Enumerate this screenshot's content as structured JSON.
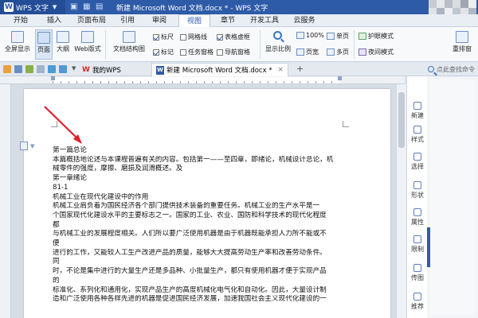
{
  "titlebar": {
    "app_name": "WPS 文字",
    "doc_title": "新建 Microsoft Word 文档.docx * - WPS 文字"
  },
  "menu_tabs": [
    "开始",
    "插入",
    "页面布局",
    "引用",
    "审阅",
    "视图",
    "章节",
    "开发工具",
    "云服务"
  ],
  "active_menu_tab": "视图",
  "ribbon": {
    "fullscreen": "全屏显示",
    "page_view": "页面",
    "outline": "大纲",
    "web_view": "Web版式",
    "doc_map": "文档结构图",
    "ruler": "标尺",
    "gridlines": "网格线",
    "table_gridlines": "表格虚框",
    "markup": "标记",
    "task_pane": "任务窗格",
    "nav_window": "导航窗格",
    "zoom": "显示比例",
    "zoom_100": "100%",
    "one_page": "单页",
    "page_width": "页宽",
    "multi_page": "多页",
    "eye_protect": "护眼模式",
    "night_mode": "夜间模式",
    "rearrange": "重排窗"
  },
  "doc_tabs": [
    {
      "label": "我的WPS"
    },
    {
      "label": "新建 Microsoft Word 文档.docx *"
    }
  ],
  "new_tab": "+",
  "search": {
    "placeholder": "点此查找命令"
  },
  "document_lines": [
    "第一篇总论",
    "本篇概括地论述与本课程普遍有关的内容。包括第一——至四章，即绪论，机械设计总论，机",
    "械零件的强度，摩擦、磨损及润滑概述。及",
    "第一章绪论",
    "81-1",
    "机械工业在现代化建设中的作用",
    "机械工业肩负着为国民经济各个部门提供技术装备的重要任务。机械工业的生产水平是一",
    "个国家现代化建设水平的主要标志之一。国家的工业、农业、国防和科学技术的现代化程度",
    "都",
    "与机械工业的发展程度相关。人们所以要广泛使用机器是由于机器既能承担人力所不能或不",
    "便",
    "进行的工作，又能较人工生产改进产品的质量，能够大大提高劳动生产率和改善劳动条件。",
    "同",
    "时，不论是集中进行的大量生产还是多品种、小批量生产，都只有使用机器才便于实现产品",
    "的",
    "标准化、系列化和通用化，实现产品生产的高度机械化电气化和自动化。因此，大量设计制",
    "造和广泛使用各种各样先进的机器是促进国民经济发展，加速我国社会主义现代化建设的一"
  ],
  "right_panel": [
    "新建",
    "样式",
    "选择",
    "形状",
    "属性",
    "限制",
    "传图",
    "推荐"
  ],
  "colors": {
    "accent": "#2e5ba8",
    "arrow": "#e0202a"
  }
}
